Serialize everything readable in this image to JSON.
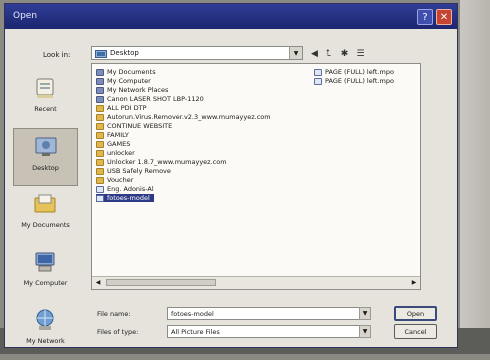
{
  "window": {
    "title": "Open"
  },
  "toolbar": {
    "look_in_label": "Look in:",
    "look_in_value": "Desktop"
  },
  "places": [
    {
      "label": "Recent",
      "icon": "recent-icon"
    },
    {
      "label": "Desktop",
      "icon": "desktop-icon",
      "selected": true
    },
    {
      "label": "My Documents",
      "icon": "documents-icon"
    },
    {
      "label": "My Computer",
      "icon": "computer-icon"
    },
    {
      "label": "My Network",
      "icon": "network-icon"
    }
  ],
  "files": [
    {
      "name": "My Documents",
      "icon": "sys"
    },
    {
      "name": "My Computer",
      "icon": "sys"
    },
    {
      "name": "My Network Places",
      "icon": "sys"
    },
    {
      "name": "Canon LASER SHOT LBP-1120",
      "icon": "sys"
    },
    {
      "name": "ALL PDI DTP",
      "icon": "folder"
    },
    {
      "name": "Autorun.Virus.Remover.v2.3_www.mumayyez.com",
      "icon": "folder"
    },
    {
      "name": "CONTINUE WEBSITE",
      "icon": "folder"
    },
    {
      "name": "FAMILY",
      "icon": "folder"
    },
    {
      "name": "GAMES",
      "icon": "folder"
    },
    {
      "name": "unlocker",
      "icon": "folder"
    },
    {
      "name": "Unlocker 1.8.7_www.mumayyez.com",
      "icon": "folder"
    },
    {
      "name": "USB Safely Remove",
      "icon": "folder"
    },
    {
      "name": "Voucher",
      "icon": "folder"
    },
    {
      "name": "Eng. Adonis-Al",
      "icon": "doc"
    },
    {
      "name": "fotoes-model",
      "icon": "doc",
      "selected": true
    },
    {
      "name": "PAGE (FULL) left.mpo",
      "icon": "doc"
    },
    {
      "name": "PAGE (FULL) left.mpo",
      "icon": "doc"
    }
  ],
  "form": {
    "file_name_label": "File name:",
    "file_name_value": "fotoes-model",
    "file_type_label": "Files of type:",
    "file_type_value": "All Picture Files"
  },
  "buttons": {
    "open": "Open",
    "cancel": "Cancel"
  },
  "colors": {
    "titlebar": "#23307f",
    "selection": "#2d3a86",
    "dialog_face": "#e6e3dc"
  }
}
